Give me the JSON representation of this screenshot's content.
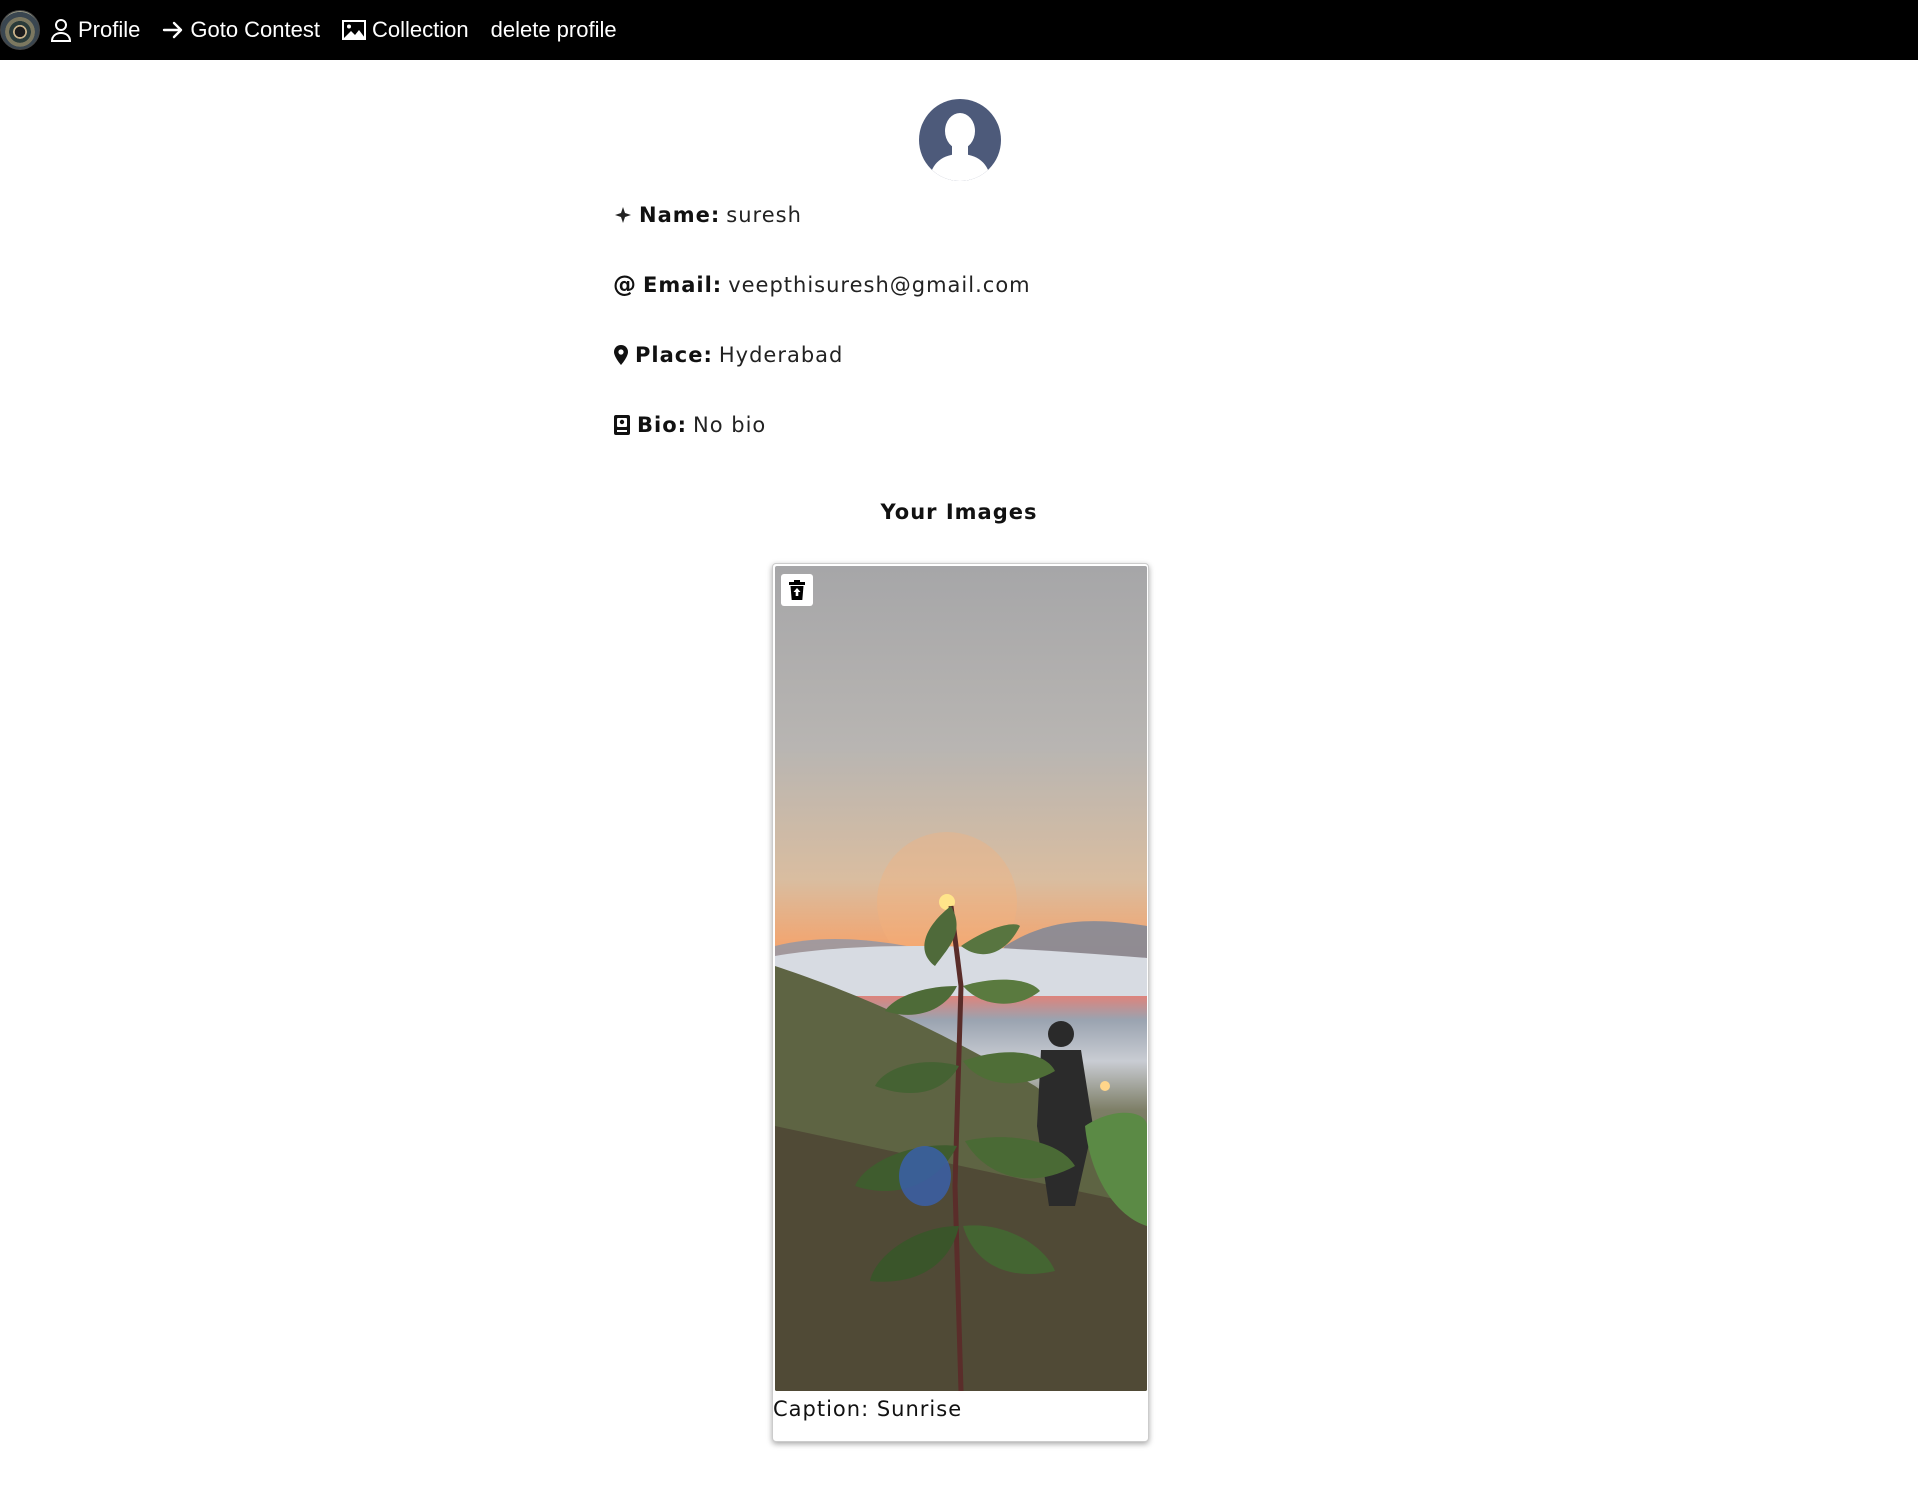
{
  "navbar": {
    "logo_icon": "camera-lens-logo",
    "items": [
      {
        "label": "Profile",
        "icon": "user-icon"
      },
      {
        "label": "Goto Contest",
        "icon": "arrow-right-icon"
      },
      {
        "label": "Collection",
        "icon": "image-icon"
      },
      {
        "label": "delete profile",
        "icon": ""
      }
    ]
  },
  "profile": {
    "avatar_icon": "user-silhouette-icon",
    "name": {
      "label": "Name:",
      "value": "suresh",
      "icon": "compass-icon"
    },
    "email": {
      "label": "Email:",
      "value": "veepthisuresh@gmail.com",
      "icon": "at-icon"
    },
    "place": {
      "label": "Place:",
      "value": "Hyderabad",
      "icon": "location-pin-icon"
    },
    "bio": {
      "label": "Bio:",
      "value": "No bio",
      "icon": "book-icon"
    }
  },
  "images_section": {
    "title": "Your Images",
    "images": [
      {
        "caption": "Caption: Sunrise",
        "delete_icon": "trash-icon"
      }
    ]
  },
  "colors": {
    "navbar_bg": "#000000",
    "avatar_bg": "#4d5a7a"
  }
}
